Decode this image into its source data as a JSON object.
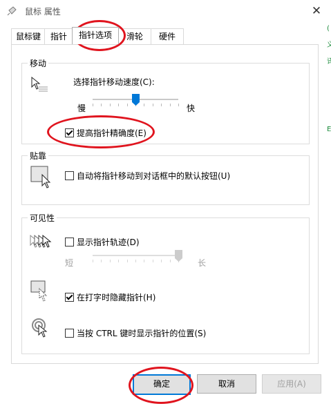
{
  "window": {
    "title": "鼠标 属性"
  },
  "tabs": [
    {
      "label": "鼠标键"
    },
    {
      "label": "指针"
    },
    {
      "label": "指针选项"
    },
    {
      "label": "滑轮"
    },
    {
      "label": "硬件"
    }
  ],
  "motion": {
    "group_title": "移动",
    "speed_label": "选择指针移动速度(C):",
    "slow_label": "慢",
    "fast_label": "快",
    "speed_value": 0.5,
    "enhance_precision": {
      "label": "提高指针精确度(E)",
      "checked": true
    }
  },
  "snap": {
    "group_title": "贴靠",
    "snap_to_default": {
      "label": "自动将指针移动到对话框中的默认按钮(U)",
      "checked": false
    }
  },
  "visibility": {
    "group_title": "可见性",
    "trails": {
      "label": "显示指针轨迹(D)",
      "checked": false
    },
    "short_label": "短",
    "long_label": "长",
    "trail_length_value": 1.0,
    "hide_typing": {
      "label": "在打字时隐藏指针(H)",
      "checked": true
    },
    "show_ctrl": {
      "label": "当按 CTRL 键时显示指针的位置(S)",
      "checked": false
    }
  },
  "buttons": {
    "ok": "确定",
    "cancel": "取消",
    "apply": "应用(A)"
  },
  "colors": {
    "accent": "#0078d7",
    "annotation": "#e0141e"
  }
}
